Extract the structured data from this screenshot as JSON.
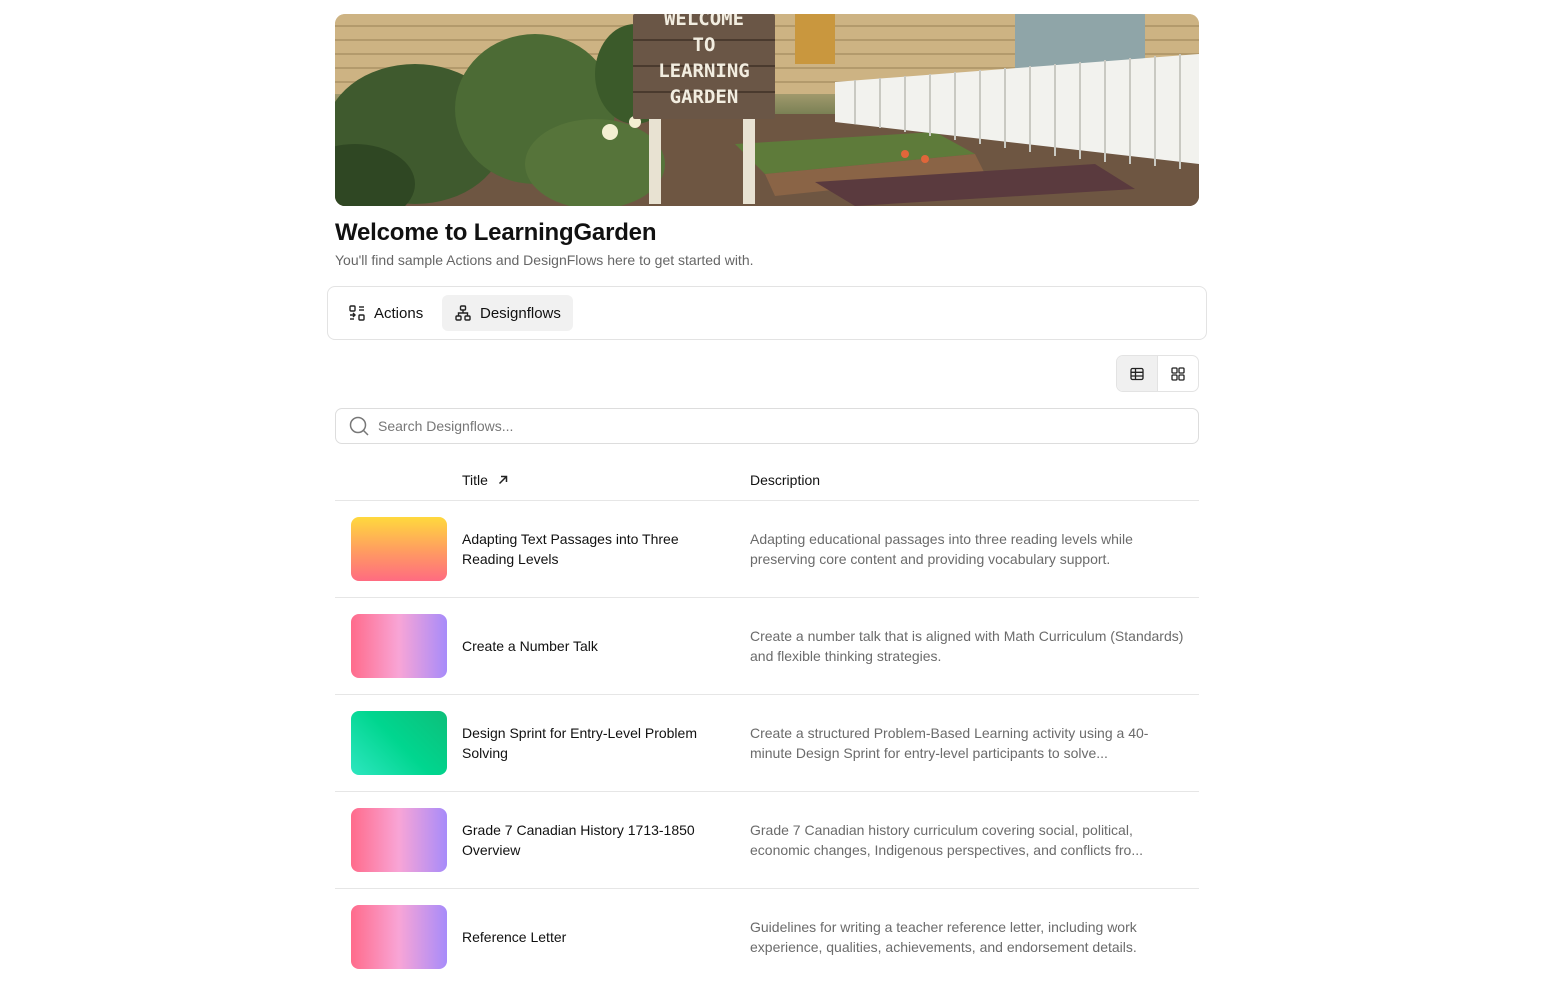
{
  "header": {
    "banner_sign_lines": [
      "WELCOME",
      "TO",
      "LEARNING",
      "GARDEN"
    ],
    "title": "Welcome to LearningGarden",
    "subtitle": "You'll find sample Actions and DesignFlows here to get started with."
  },
  "tabs": [
    {
      "label": "Actions",
      "icon": "actions-icon",
      "active": false
    },
    {
      "label": "Designflows",
      "icon": "designflows-icon",
      "active": true
    }
  ],
  "view_toggle": {
    "options": [
      "table-view-icon",
      "grid-view-icon"
    ],
    "active": "table"
  },
  "search": {
    "placeholder": "Search Designflows...",
    "value": ""
  },
  "table": {
    "columns": {
      "title": "Title",
      "description": "Description"
    },
    "sort": {
      "column": "Title",
      "direction": "ascending",
      "icon": "arrow-up-right-icon"
    },
    "rows": [
      {
        "title": "Adapting Text Passages into Three Reading Levels",
        "description": "Adapting educational passages into three reading levels while preserving core content and providing vocabulary support.",
        "thumb_colors": [
          "#ffd93d",
          "#ff6b81"
        ]
      },
      {
        "title": "Create a Number Talk",
        "description": "Create a number talk that is aligned with Math Curriculum (Standards) and flexible thinking strategies.",
        "thumb_colors": [
          "#ff6b8b",
          "#f8a5d6",
          "#a78bfa"
        ]
      },
      {
        "title": "Design Sprint for Entry-Level Problem Solving",
        "description": "Create a structured Problem-Based Learning activity using a 40-minute Design Sprint for entry-level participants to solve...",
        "thumb_colors": [
          "#2ee6c0",
          "#00d68f",
          "#0dbf7a"
        ]
      },
      {
        "title": "Grade 7 Canadian History 1713-1850 Overview",
        "description": "Grade 7 Canadian history curriculum covering social, political, economic changes, Indigenous perspectives, and conflicts fro...",
        "thumb_colors": [
          "#ff6b8b",
          "#f8a5d6",
          "#a78bfa"
        ]
      },
      {
        "title": "Reference Letter",
        "description": "Guidelines for writing a teacher reference letter, including work experience, qualities, achievements, and endorsement details.",
        "thumb_colors": [
          "#ff6b8b",
          "#f8a5d6",
          "#a78bfa"
        ]
      }
    ]
  }
}
